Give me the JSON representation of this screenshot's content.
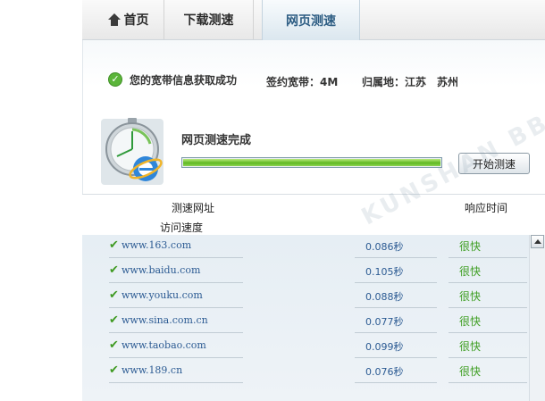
{
  "tabs": [
    {
      "label": "首页",
      "icon": "home-icon"
    },
    {
      "label": "下载测速"
    },
    {
      "label": "网页测速",
      "active": true
    }
  ],
  "info": {
    "message": "您的宽带信息获取成功",
    "bandwidth": "签约宽带：4M",
    "region": "归属地：江苏　苏州"
  },
  "status": {
    "title": "网页测速完成",
    "progress": 1.0,
    "start_button": "开始测速"
  },
  "table": {
    "col_url": "测速网址",
    "col_speed": "访问速度",
    "col_response": "响应时间",
    "rows": [
      {
        "url": "www.163.com",
        "time": "0.086秒",
        "rating": "很快"
      },
      {
        "url": "www.baidu.com",
        "time": "0.105秒",
        "rating": "很快"
      },
      {
        "url": "www.youku.com",
        "time": "0.088秒",
        "rating": "很快"
      },
      {
        "url": "www.sina.com.cn",
        "time": "0.077秒",
        "rating": "很快"
      },
      {
        "url": "www.taobao.com",
        "time": "0.099秒",
        "rating": "很快"
      },
      {
        "url": "www.189.cn",
        "time": "0.076秒",
        "rating": "很快"
      }
    ]
  },
  "watermark": "KUNSHAN BBS",
  "colors": {
    "accent": "#2d5d83",
    "success": "#5fb923",
    "link": "#2c5b93"
  }
}
